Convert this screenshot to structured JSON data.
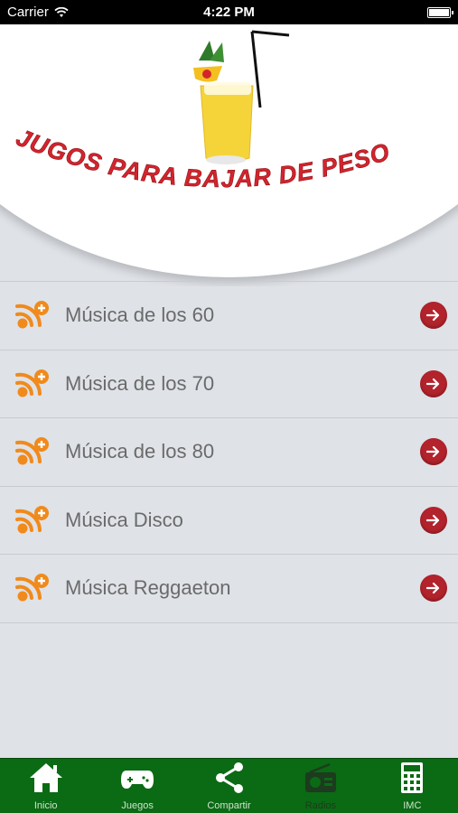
{
  "status_bar": {
    "carrier": "Carrier",
    "time": "4:22 PM"
  },
  "header": {
    "title": "JUGOS PARA BAJAR DE PESO"
  },
  "stations": [
    {
      "label": "Música de los 60",
      "icon": "rss-plus-icon"
    },
    {
      "label": "Música de los 70",
      "icon": "rss-plus-icon"
    },
    {
      "label": "Música de los 80",
      "icon": "rss-plus-icon"
    },
    {
      "label": "Música Disco",
      "icon": "rss-plus-icon"
    },
    {
      "label": "Música Reggaeton",
      "icon": "rss-plus-icon"
    }
  ],
  "tab_bar": {
    "tabs": [
      {
        "label": "Inicio",
        "icon": "home-icon"
      },
      {
        "label": "Juegos",
        "icon": "gamepad-icon"
      },
      {
        "label": "Compartir",
        "icon": "share-icon"
      },
      {
        "label": "Radios",
        "icon": "radio-icon",
        "active": true
      },
      {
        "label": "IMC",
        "icon": "calculator-icon"
      }
    ]
  },
  "colors": {
    "accent_red": "#b3232c",
    "tab_green": "#0b6a14",
    "title_red": "#d3242d",
    "icon_orange": "#f08a1c"
  }
}
